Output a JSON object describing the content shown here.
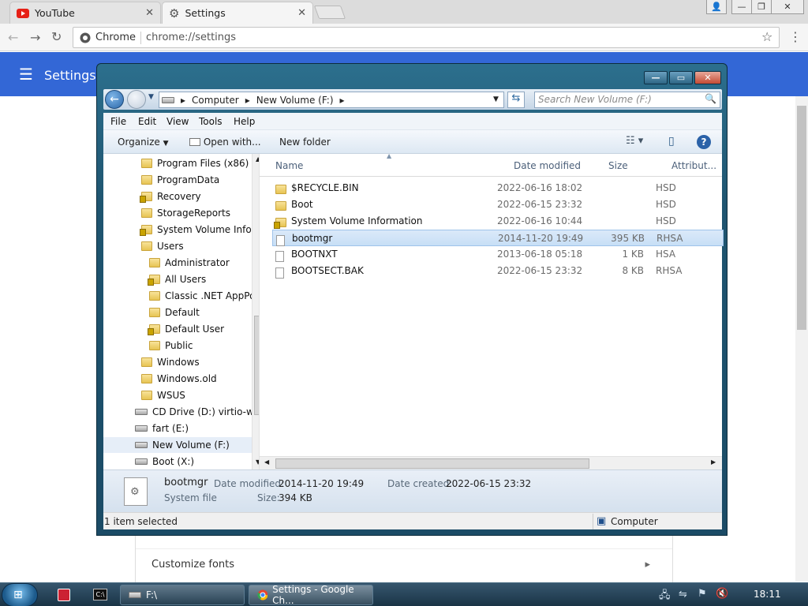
{
  "browser": {
    "tabs": [
      {
        "label": "YouTube",
        "icon": "youtube-icon",
        "active": false
      },
      {
        "label": "Settings",
        "icon": "gear-icon",
        "active": true
      }
    ],
    "omnibox": {
      "site_label": "Chrome",
      "url": "chrome://settings"
    },
    "accent": "#3367d6"
  },
  "settings": {
    "title": "Settings",
    "rows": [
      {
        "label": "Customize fonts"
      }
    ]
  },
  "explorer": {
    "breadcrumb": [
      "Computer",
      "New Volume (F:)"
    ],
    "search_placeholder": "Search New Volume (F:)",
    "menu": [
      "File",
      "Edit",
      "View",
      "Tools",
      "Help"
    ],
    "commands": {
      "organize": "Organize",
      "open_with": "Open with...",
      "new_folder": "New folder"
    },
    "tree": [
      {
        "label": "Program Files (x86)",
        "type": "folder",
        "lock": false
      },
      {
        "label": "ProgramData",
        "type": "folder",
        "lock": false
      },
      {
        "label": "Recovery",
        "type": "folder",
        "lock": true
      },
      {
        "label": "StorageReports",
        "type": "folder",
        "lock": false
      },
      {
        "label": "System Volume Inform",
        "type": "folder",
        "lock": true
      },
      {
        "label": "Users",
        "type": "folder",
        "lock": false
      },
      {
        "label": "Administrator",
        "type": "folder",
        "lock": false
      },
      {
        "label": "All Users",
        "type": "folder",
        "lock": true
      },
      {
        "label": "Classic .NET AppPoo",
        "type": "folder",
        "lock": false
      },
      {
        "label": "Default",
        "type": "folder",
        "lock": false
      },
      {
        "label": "Default User",
        "type": "folder",
        "lock": true
      },
      {
        "label": "Public",
        "type": "folder",
        "lock": false
      },
      {
        "label": "Windows",
        "type": "folder",
        "lock": false
      },
      {
        "label": "Windows.old",
        "type": "folder",
        "lock": false
      },
      {
        "label": "WSUS",
        "type": "folder",
        "lock": false
      },
      {
        "label": "CD Drive (D:) virtio-win-",
        "type": "cdrive",
        "lock": false
      },
      {
        "label": "fart (E:)",
        "type": "drive",
        "lock": false
      },
      {
        "label": "New Volume (F:)",
        "type": "drive",
        "lock": false,
        "selected": true
      },
      {
        "label": "Boot (X:)",
        "type": "drive",
        "lock": false
      }
    ],
    "columns": {
      "name": "Name",
      "date": "Date modified",
      "size": "Size",
      "attr": "Attribut..."
    },
    "files": [
      {
        "name": "$RECYCLE.BIN",
        "date": "2022-06-16 18:02",
        "size": "",
        "attr": "HSD",
        "type": "folder"
      },
      {
        "name": "Boot",
        "date": "2022-06-15 23:32",
        "size": "",
        "attr": "HSD",
        "type": "folder"
      },
      {
        "name": "System Volume Information",
        "date": "2022-06-16 10:44",
        "size": "",
        "attr": "HSD",
        "type": "folder-lock"
      },
      {
        "name": "bootmgr",
        "date": "2014-11-20 19:49",
        "size": "395 KB",
        "attr": "RHSA",
        "type": "sysfile",
        "selected": true
      },
      {
        "name": "BOOTNXT",
        "date": "2013-06-18 05:18",
        "size": "1 KB",
        "attr": "HSA",
        "type": "sysfile"
      },
      {
        "name": "BOOTSECT.BAK",
        "date": "2022-06-15 23:32",
        "size": "8 KB",
        "attr": "RHSA",
        "type": "file"
      }
    ],
    "details": {
      "name": "bootmgr",
      "type": "System file",
      "modified_label": "Date modified:",
      "modified": "2014-11-20 19:49",
      "created_label": "Date created:",
      "created": "2022-06-15 23:32",
      "size_label": "Size:",
      "size": "394 KB"
    },
    "status": {
      "selected": "1 item selected",
      "location": "Computer"
    }
  },
  "taskbar": {
    "buttons": [
      {
        "label": "F:\\",
        "icon": "explorer-icon"
      },
      {
        "label": "Settings - Google Ch...",
        "icon": "chrome-icon"
      }
    ],
    "clock": "18:11"
  }
}
